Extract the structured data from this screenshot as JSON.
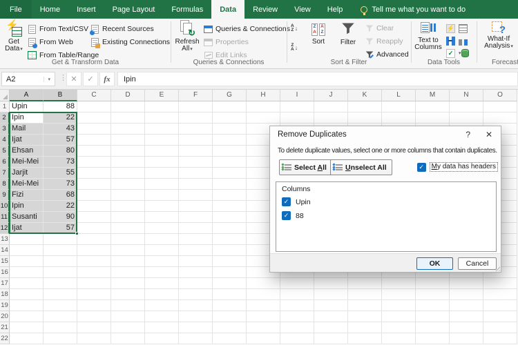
{
  "app": {
    "accent_green": "#217346",
    "checkbox_blue": "#0f6cbd"
  },
  "tabs": {
    "items": [
      {
        "label": "File"
      },
      {
        "label": "Home"
      },
      {
        "label": "Insert"
      },
      {
        "label": "Page Layout"
      },
      {
        "label": "Formulas"
      },
      {
        "label": "Data",
        "active": true
      },
      {
        "label": "Review"
      },
      {
        "label": "View"
      },
      {
        "label": "Help"
      }
    ],
    "tell_me": "Tell me what you want to do"
  },
  "ribbon": {
    "get_transform": {
      "label": "Get & Transform Data",
      "get_data": "Get Data",
      "items_col1": [
        "From Text/CSV",
        "From Web",
        "From Table/Range"
      ],
      "items_col2": [
        "Recent Sources",
        "Existing Connections"
      ]
    },
    "queries": {
      "label": "Queries & Connections",
      "refresh_line1": "Refresh",
      "refresh_line2": "All",
      "items": [
        {
          "label": "Queries & Connections",
          "disabled": false
        },
        {
          "label": "Properties",
          "disabled": true
        },
        {
          "label": "Edit Links",
          "disabled": true
        }
      ]
    },
    "sort_filter": {
      "label": "Sort & Filter",
      "sort": "Sort",
      "filter": "Filter",
      "items": [
        {
          "label": "Clear",
          "disabled": true
        },
        {
          "label": "Reapply",
          "disabled": true
        },
        {
          "label": "Advanced",
          "disabled": false
        }
      ]
    },
    "data_tools": {
      "label": "Data Tools",
      "text_to_columns_1": "Text to",
      "text_to_columns_2": "Columns"
    },
    "forecast": {
      "label": "Forecast",
      "what_if_1": "What-If",
      "what_if_2": "Analysis"
    }
  },
  "formula_bar": {
    "name_box": "A2",
    "formula": "Ipin",
    "fx": "fx"
  },
  "grid": {
    "columns": [
      "A",
      "B",
      "C",
      "D",
      "E",
      "F",
      "G",
      "H",
      "I",
      "J",
      "K",
      "L",
      "M",
      "N",
      "O"
    ],
    "visible_rows": 22,
    "active_cell": "A2",
    "selection": {
      "col_start": "A",
      "col_end": "B",
      "row_start": 2,
      "row_end": 12
    },
    "data": [
      {
        "row": 1,
        "A": "Upin",
        "B": "88"
      },
      {
        "row": 2,
        "A": "Ipin",
        "B": "22"
      },
      {
        "row": 3,
        "A": "Mail",
        "B": "43"
      },
      {
        "row": 4,
        "A": "Ijat",
        "B": "57"
      },
      {
        "row": 5,
        "A": "Ehsan",
        "B": "80"
      },
      {
        "row": 6,
        "A": "Mei-Mei",
        "B": "73"
      },
      {
        "row": 7,
        "A": "Jarjit",
        "B": "55"
      },
      {
        "row": 8,
        "A": "Mei-Mei",
        "B": "73"
      },
      {
        "row": 9,
        "A": "Fizi",
        "B": "68"
      },
      {
        "row": 10,
        "A": "Ipin",
        "B": "22"
      },
      {
        "row": 11,
        "A": "Susanti",
        "B": "90"
      },
      {
        "row": 12,
        "A": "Ijat",
        "B": "57"
      }
    ]
  },
  "dialog": {
    "title": "Remove Duplicates",
    "help_icon": "?",
    "close_icon": "✕",
    "description": "To delete duplicate values, select one or more columns that contain duplicates.",
    "select_all": {
      "pre": "Select ",
      "u": "A",
      "post": "ll"
    },
    "unselect_all": {
      "pre": "",
      "u": "U",
      "post": "nselect All"
    },
    "headers_checkbox": {
      "pre": "",
      "u": "M",
      "post": "y data has headers",
      "checked": true
    },
    "columns_label": "Columns",
    "columns": [
      {
        "label": "Upin",
        "checked": true
      },
      {
        "label": "88",
        "checked": true
      }
    ],
    "ok": "OK",
    "cancel": "Cancel"
  }
}
